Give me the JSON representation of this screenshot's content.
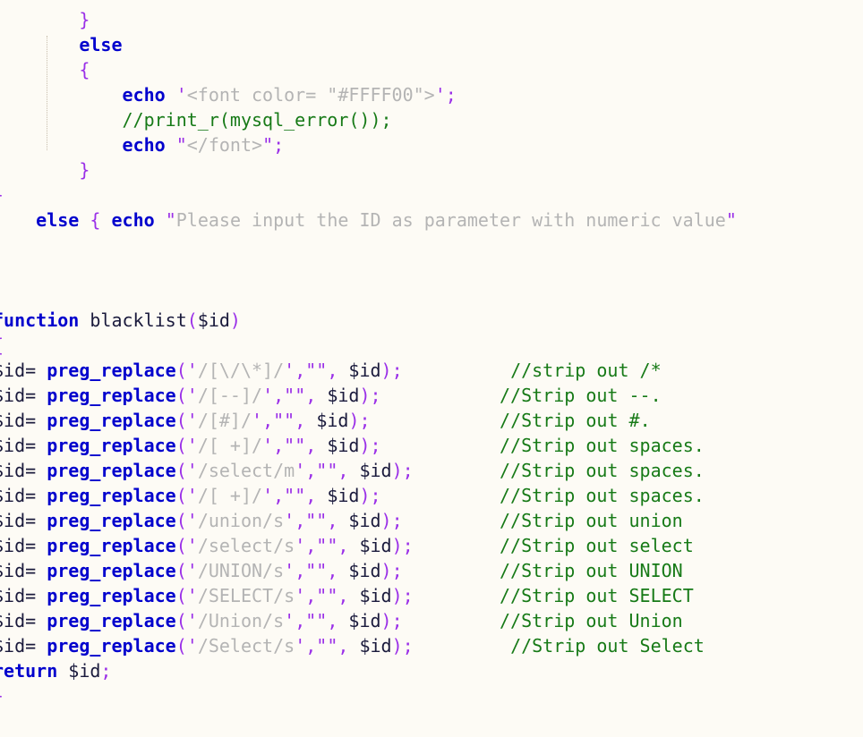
{
  "editor": {
    "language": "PHP",
    "background_color": "#fdfbf5",
    "font_size_px": 20,
    "line_height_px": 28,
    "colors": {
      "keyword": "#0000cd",
      "function": "#0000cd",
      "punctuation": "#9a2fe8",
      "string": "#b4b4b4",
      "comment": "#177a17",
      "identifier": "#1a1a3c",
      "background": "#fdfbf5",
      "indent_guide": "#c9bfae"
    }
  },
  "code": {
    "lines": [
      {
        "id": "l01",
        "text": "        }"
      },
      {
        "id": "l02",
        "text": "        else"
      },
      {
        "id": "l03",
        "text": "        {"
      },
      {
        "id": "l04",
        "text": "            echo '<font color= \"#FFFF00\">';"
      },
      {
        "id": "l05",
        "text": "            //print_r(mysql_error());"
      },
      {
        "id": "l06",
        "text": "            echo \"</font>\";"
      },
      {
        "id": "l07",
        "text": "        }"
      },
      {
        "id": "l08",
        "text": "}"
      },
      {
        "id": "l09",
        "text": "    else { echo \"Please input the ID as parameter with numeric value\""
      },
      {
        "id": "l10",
        "text": ""
      },
      {
        "id": "l11",
        "text": ""
      },
      {
        "id": "l12",
        "text": ""
      },
      {
        "id": "l13",
        "text": "function blacklist($id)"
      },
      {
        "id": "l14",
        "text": "{"
      },
      {
        "id": "l15",
        "text": "$id= preg_replace('/[\\/\\*]/',\"\", $id);          //strip out /*"
      },
      {
        "id": "l16",
        "text": "$id= preg_replace('/[--]/',\"\", $id);           //Strip out --."
      },
      {
        "id": "l17",
        "text": "$id= preg_replace('/[#]/',\"\", $id);            //Strip out #."
      },
      {
        "id": "l18",
        "text": "$id= preg_replace('/[ +]/',\"\", $id);           //Strip out spaces."
      },
      {
        "id": "l19",
        "text": "$id= preg_replace('/select/m',\"\", $id);        //Strip out spaces."
      },
      {
        "id": "l20",
        "text": "$id= preg_replace('/[ +]/',\"\", $id);           //Strip out spaces."
      },
      {
        "id": "l21",
        "text": "$id= preg_replace('/union/s',\"\", $id);         //Strip out union"
      },
      {
        "id": "l22",
        "text": "$id= preg_replace('/select/s',\"\", $id);        //Strip out select"
      },
      {
        "id": "l23",
        "text": "$id= preg_replace('/UNION/s',\"\", $id);         //Strip out UNION"
      },
      {
        "id": "l24",
        "text": "$id= preg_replace('/SELECT/s',\"\", $id);        //Strip out SELECT"
      },
      {
        "id": "l25",
        "text": "$id= preg_replace('/Union/s',\"\", $id);         //Strip out Union"
      },
      {
        "id": "l26",
        "text": "$id= preg_replace('/Select/s',\"\", $id);        //Strip out Select"
      },
      {
        "id": "l27",
        "text": "return $id;"
      },
      {
        "id": "l28",
        "text": "}"
      }
    ],
    "keywords": [
      "else",
      "echo",
      "function",
      "return"
    ],
    "functions": [
      "preg_replace",
      "print_r",
      "mysql_error",
      "blacklist"
    ],
    "comments": [
      "//print_r(mysql_error());",
      "//strip out /*",
      "//Strip out --.",
      "//Strip out #.",
      "//Strip out spaces.",
      "//Strip out spaces.",
      "//Strip out spaces.",
      "//Strip out union",
      "//Strip out select",
      "//Strip out UNION",
      "//Strip out SELECT",
      "//Strip out Union",
      "//Strip out Select"
    ],
    "strings": [
      "'<font color= \"#FFFF00\">'",
      "\"</font>\"",
      "\"Please input the ID as parameter with numeric value\"",
      "'/[\\/\\*]/'",
      "'/[--]/'",
      "'/[#]/'",
      "'/[ +]/'",
      "'/select/m'",
      "'/union/s'",
      "'/select/s'",
      "'/UNION/s'",
      "'/SELECT/s'",
      "'/Union/s'",
      "'/Select/s'",
      "\"\""
    ]
  },
  "tokens": {
    "l01": [
      {
        "t": "        ",
        "c": "ws"
      },
      {
        "t": "}",
        "c": "pun"
      }
    ],
    "l02": [
      {
        "t": "        ",
        "c": "ws"
      },
      {
        "t": "else",
        "c": "kw"
      }
    ],
    "l03": [
      {
        "t": "        ",
        "c": "ws"
      },
      {
        "t": "{",
        "c": "pun"
      }
    ],
    "l04": [
      {
        "t": "            ",
        "c": "ws"
      },
      {
        "t": "echo",
        "c": "kw"
      },
      {
        "t": " ",
        "c": "ws"
      },
      {
        "t": "'",
        "c": "pun"
      },
      {
        "t": "<font color= \"#FFFF00\">",
        "c": "str"
      },
      {
        "t": "'",
        "c": "pun"
      },
      {
        "t": ";",
        "c": "pun"
      }
    ],
    "l05": [
      {
        "t": "            ",
        "c": "ws"
      },
      {
        "t": "//print_r(mysql_error());",
        "c": "cmt"
      }
    ],
    "l06": [
      {
        "t": "            ",
        "c": "ws"
      },
      {
        "t": "echo",
        "c": "kw"
      },
      {
        "t": " ",
        "c": "ws"
      },
      {
        "t": "\"",
        "c": "pun"
      },
      {
        "t": "</font>",
        "c": "str"
      },
      {
        "t": "\"",
        "c": "pun"
      },
      {
        "t": ";",
        "c": "pun"
      }
    ],
    "l07": [
      {
        "t": "        ",
        "c": "ws"
      },
      {
        "t": "}",
        "c": "pun"
      }
    ],
    "l08": [
      {
        "t": "}",
        "c": "pun"
      }
    ],
    "l09": [
      {
        "t": "    ",
        "c": "ws"
      },
      {
        "t": "else",
        "c": "kw"
      },
      {
        "t": " ",
        "c": "ws"
      },
      {
        "t": "{",
        "c": "pun"
      },
      {
        "t": " ",
        "c": "ws"
      },
      {
        "t": "echo",
        "c": "kw"
      },
      {
        "t": " ",
        "c": "ws"
      },
      {
        "t": "\"",
        "c": "pun"
      },
      {
        "t": "Please input the ID as parameter with numeric value",
        "c": "str"
      },
      {
        "t": "\"",
        "c": "pun"
      }
    ],
    "l10": [],
    "l11": [],
    "l12": [],
    "l13": [
      {
        "t": "function",
        "c": "kw"
      },
      {
        "t": " ",
        "c": "ws"
      },
      {
        "t": "blacklist",
        "c": "id"
      },
      {
        "t": "(",
        "c": "pun"
      },
      {
        "t": "$id",
        "c": "id"
      },
      {
        "t": ")",
        "c": "pun"
      }
    ],
    "l14": [
      {
        "t": "{",
        "c": "pun"
      }
    ],
    "l15": [
      {
        "t": "$id",
        "c": "id"
      },
      {
        "t": "=",
        "c": "op"
      },
      {
        "t": " ",
        "c": "ws"
      },
      {
        "t": "preg_replace",
        "c": "fn"
      },
      {
        "t": "(",
        "c": "pun"
      },
      {
        "t": "'",
        "c": "pun"
      },
      {
        "t": "/[\\/\\*]/",
        "c": "str"
      },
      {
        "t": "'",
        "c": "pun"
      },
      {
        "t": ",",
        "c": "pun"
      },
      {
        "t": "\"\"",
        "c": "pun"
      },
      {
        "t": ",",
        "c": "pun"
      },
      {
        "t": " ",
        "c": "ws"
      },
      {
        "t": "$id",
        "c": "id"
      },
      {
        "t": ")",
        "c": "pun"
      },
      {
        "t": ";",
        "c": "pun"
      },
      {
        "t": "          ",
        "c": "ws"
      },
      {
        "t": "//strip out /*",
        "c": "cmt"
      }
    ],
    "l16": [
      {
        "t": "$id",
        "c": "id"
      },
      {
        "t": "=",
        "c": "op"
      },
      {
        "t": " ",
        "c": "ws"
      },
      {
        "t": "preg_replace",
        "c": "fn"
      },
      {
        "t": "(",
        "c": "pun"
      },
      {
        "t": "'",
        "c": "pun"
      },
      {
        "t": "/[--]/",
        "c": "str"
      },
      {
        "t": "'",
        "c": "pun"
      },
      {
        "t": ",",
        "c": "pun"
      },
      {
        "t": "\"\"",
        "c": "pun"
      },
      {
        "t": ",",
        "c": "pun"
      },
      {
        "t": " ",
        "c": "ws"
      },
      {
        "t": "$id",
        "c": "id"
      },
      {
        "t": ")",
        "c": "pun"
      },
      {
        "t": ";",
        "c": "pun"
      },
      {
        "t": "           ",
        "c": "ws"
      },
      {
        "t": "//Strip out --.",
        "c": "cmt"
      }
    ],
    "l17": [
      {
        "t": "$id",
        "c": "id"
      },
      {
        "t": "=",
        "c": "op"
      },
      {
        "t": " ",
        "c": "ws"
      },
      {
        "t": "preg_replace",
        "c": "fn"
      },
      {
        "t": "(",
        "c": "pun"
      },
      {
        "t": "'",
        "c": "pun"
      },
      {
        "t": "/[#]/",
        "c": "str"
      },
      {
        "t": "'",
        "c": "pun"
      },
      {
        "t": ",",
        "c": "pun"
      },
      {
        "t": "\"\"",
        "c": "pun"
      },
      {
        "t": ",",
        "c": "pun"
      },
      {
        "t": " ",
        "c": "ws"
      },
      {
        "t": "$id",
        "c": "id"
      },
      {
        "t": ")",
        "c": "pun"
      },
      {
        "t": ";",
        "c": "pun"
      },
      {
        "t": "            ",
        "c": "ws"
      },
      {
        "t": "//Strip out #.",
        "c": "cmt"
      }
    ],
    "l18": [
      {
        "t": "$id",
        "c": "id"
      },
      {
        "t": "=",
        "c": "op"
      },
      {
        "t": " ",
        "c": "ws"
      },
      {
        "t": "preg_replace",
        "c": "fn"
      },
      {
        "t": "(",
        "c": "pun"
      },
      {
        "t": "'",
        "c": "pun"
      },
      {
        "t": "/[ +]/",
        "c": "str"
      },
      {
        "t": "'",
        "c": "pun"
      },
      {
        "t": ",",
        "c": "pun"
      },
      {
        "t": "\"\"",
        "c": "pun"
      },
      {
        "t": ",",
        "c": "pun"
      },
      {
        "t": " ",
        "c": "ws"
      },
      {
        "t": "$id",
        "c": "id"
      },
      {
        "t": ")",
        "c": "pun"
      },
      {
        "t": ";",
        "c": "pun"
      },
      {
        "t": "           ",
        "c": "ws"
      },
      {
        "t": "//Strip out spaces.",
        "c": "cmt"
      }
    ],
    "l19": [
      {
        "t": "$id",
        "c": "id"
      },
      {
        "t": "=",
        "c": "op"
      },
      {
        "t": " ",
        "c": "ws"
      },
      {
        "t": "preg_replace",
        "c": "fn"
      },
      {
        "t": "(",
        "c": "pun"
      },
      {
        "t": "'",
        "c": "pun"
      },
      {
        "t": "/select/m",
        "c": "str"
      },
      {
        "t": "'",
        "c": "pun"
      },
      {
        "t": ",",
        "c": "pun"
      },
      {
        "t": "\"\"",
        "c": "pun"
      },
      {
        "t": ",",
        "c": "pun"
      },
      {
        "t": " ",
        "c": "ws"
      },
      {
        "t": "$id",
        "c": "id"
      },
      {
        "t": ")",
        "c": "pun"
      },
      {
        "t": ";",
        "c": "pun"
      },
      {
        "t": "        ",
        "c": "ws"
      },
      {
        "t": "//Strip out spaces.",
        "c": "cmt"
      }
    ],
    "l20": [
      {
        "t": "$id",
        "c": "id"
      },
      {
        "t": "=",
        "c": "op"
      },
      {
        "t": " ",
        "c": "ws"
      },
      {
        "t": "preg_replace",
        "c": "fn"
      },
      {
        "t": "(",
        "c": "pun"
      },
      {
        "t": "'",
        "c": "pun"
      },
      {
        "t": "/[ +]/",
        "c": "str"
      },
      {
        "t": "'",
        "c": "pun"
      },
      {
        "t": ",",
        "c": "pun"
      },
      {
        "t": "\"\"",
        "c": "pun"
      },
      {
        "t": ",",
        "c": "pun"
      },
      {
        "t": " ",
        "c": "ws"
      },
      {
        "t": "$id",
        "c": "id"
      },
      {
        "t": ")",
        "c": "pun"
      },
      {
        "t": ";",
        "c": "pun"
      },
      {
        "t": "           ",
        "c": "ws"
      },
      {
        "t": "//Strip out spaces.",
        "c": "cmt"
      }
    ],
    "l21": [
      {
        "t": "$id",
        "c": "id"
      },
      {
        "t": "=",
        "c": "op"
      },
      {
        "t": " ",
        "c": "ws"
      },
      {
        "t": "preg_replace",
        "c": "fn"
      },
      {
        "t": "(",
        "c": "pun"
      },
      {
        "t": "'",
        "c": "pun"
      },
      {
        "t": "/union/s",
        "c": "str"
      },
      {
        "t": "'",
        "c": "pun"
      },
      {
        "t": ",",
        "c": "pun"
      },
      {
        "t": "\"\"",
        "c": "pun"
      },
      {
        "t": ",",
        "c": "pun"
      },
      {
        "t": " ",
        "c": "ws"
      },
      {
        "t": "$id",
        "c": "id"
      },
      {
        "t": ")",
        "c": "pun"
      },
      {
        "t": ";",
        "c": "pun"
      },
      {
        "t": "         ",
        "c": "ws"
      },
      {
        "t": "//Strip out union",
        "c": "cmt"
      }
    ],
    "l22": [
      {
        "t": "$id",
        "c": "id"
      },
      {
        "t": "=",
        "c": "op"
      },
      {
        "t": " ",
        "c": "ws"
      },
      {
        "t": "preg_replace",
        "c": "fn"
      },
      {
        "t": "(",
        "c": "pun"
      },
      {
        "t": "'",
        "c": "pun"
      },
      {
        "t": "/select/s",
        "c": "str"
      },
      {
        "t": "'",
        "c": "pun"
      },
      {
        "t": ",",
        "c": "pun"
      },
      {
        "t": "\"\"",
        "c": "pun"
      },
      {
        "t": ",",
        "c": "pun"
      },
      {
        "t": " ",
        "c": "ws"
      },
      {
        "t": "$id",
        "c": "id"
      },
      {
        "t": ")",
        "c": "pun"
      },
      {
        "t": ";",
        "c": "pun"
      },
      {
        "t": "        ",
        "c": "ws"
      },
      {
        "t": "//Strip out select",
        "c": "cmt"
      }
    ],
    "l23": [
      {
        "t": "$id",
        "c": "id"
      },
      {
        "t": "=",
        "c": "op"
      },
      {
        "t": " ",
        "c": "ws"
      },
      {
        "t": "preg_replace",
        "c": "fn"
      },
      {
        "t": "(",
        "c": "pun"
      },
      {
        "t": "'",
        "c": "pun"
      },
      {
        "t": "/UNION/s",
        "c": "str"
      },
      {
        "t": "'",
        "c": "pun"
      },
      {
        "t": ",",
        "c": "pun"
      },
      {
        "t": "\"\"",
        "c": "pun"
      },
      {
        "t": ",",
        "c": "pun"
      },
      {
        "t": " ",
        "c": "ws"
      },
      {
        "t": "$id",
        "c": "id"
      },
      {
        "t": ")",
        "c": "pun"
      },
      {
        "t": ";",
        "c": "pun"
      },
      {
        "t": "         ",
        "c": "ws"
      },
      {
        "t": "//Strip out UNION",
        "c": "cmt"
      }
    ],
    "l24": [
      {
        "t": "$id",
        "c": "id"
      },
      {
        "t": "=",
        "c": "op"
      },
      {
        "t": " ",
        "c": "ws"
      },
      {
        "t": "preg_replace",
        "c": "fn"
      },
      {
        "t": "(",
        "c": "pun"
      },
      {
        "t": "'",
        "c": "pun"
      },
      {
        "t": "/SELECT/s",
        "c": "str"
      },
      {
        "t": "'",
        "c": "pun"
      },
      {
        "t": ",",
        "c": "pun"
      },
      {
        "t": "\"\"",
        "c": "pun"
      },
      {
        "t": ",",
        "c": "pun"
      },
      {
        "t": " ",
        "c": "ws"
      },
      {
        "t": "$id",
        "c": "id"
      },
      {
        "t": ")",
        "c": "pun"
      },
      {
        "t": ";",
        "c": "pun"
      },
      {
        "t": "        ",
        "c": "ws"
      },
      {
        "t": "//Strip out SELECT",
        "c": "cmt"
      }
    ],
    "l25": [
      {
        "t": "$id",
        "c": "id"
      },
      {
        "t": "=",
        "c": "op"
      },
      {
        "t": " ",
        "c": "ws"
      },
      {
        "t": "preg_replace",
        "c": "fn"
      },
      {
        "t": "(",
        "c": "pun"
      },
      {
        "t": "'",
        "c": "pun"
      },
      {
        "t": "/Union/s",
        "c": "str"
      },
      {
        "t": "'",
        "c": "pun"
      },
      {
        "t": ",",
        "c": "pun"
      },
      {
        "t": "\"\"",
        "c": "pun"
      },
      {
        "t": ",",
        "c": "pun"
      },
      {
        "t": " ",
        "c": "ws"
      },
      {
        "t": "$id",
        "c": "id"
      },
      {
        "t": ")",
        "c": "pun"
      },
      {
        "t": ";",
        "c": "pun"
      },
      {
        "t": "         ",
        "c": "ws"
      },
      {
        "t": "//Strip out Union",
        "c": "cmt"
      }
    ],
    "l26": [
      {
        "t": "$id",
        "c": "id"
      },
      {
        "t": "=",
        "c": "op"
      },
      {
        "t": " ",
        "c": "ws"
      },
      {
        "t": "preg_replace",
        "c": "fn"
      },
      {
        "t": "(",
        "c": "pun"
      },
      {
        "t": "'",
        "c": "pun"
      },
      {
        "t": "/Select/s",
        "c": "str"
      },
      {
        "t": "'",
        "c": "pun"
      },
      {
        "t": ",",
        "c": "pun"
      },
      {
        "t": "\"\"",
        "c": "pun"
      },
      {
        "t": ",",
        "c": "pun"
      },
      {
        "t": " ",
        "c": "ws"
      },
      {
        "t": "$id",
        "c": "id"
      },
      {
        "t": ")",
        "c": "pun"
      },
      {
        "t": ";",
        "c": "pun"
      },
      {
        "t": "         ",
        "c": "ws"
      },
      {
        "t": "//Strip out Select",
        "c": "cmt"
      }
    ],
    "l27": [
      {
        "t": "return",
        "c": "kw"
      },
      {
        "t": " ",
        "c": "ws"
      },
      {
        "t": "$id",
        "c": "id"
      },
      {
        "t": ";",
        "c": "pun"
      }
    ],
    "l28": [
      {
        "t": "}",
        "c": "pun"
      }
    ]
  }
}
